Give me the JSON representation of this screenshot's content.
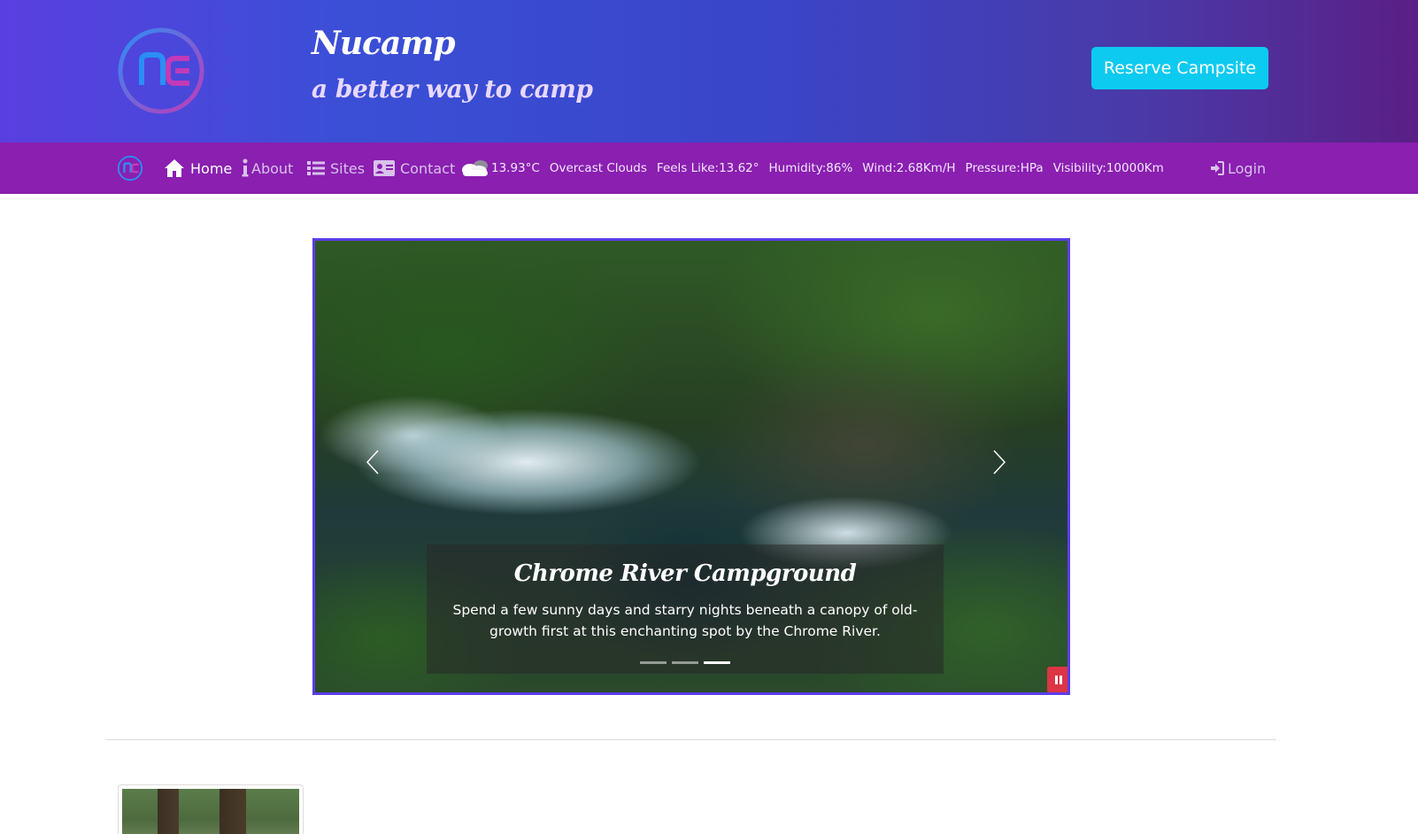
{
  "header": {
    "brand": "Nucamp",
    "tagline": "a better way to camp",
    "reserve_label": "Reserve Campsite"
  },
  "nav": {
    "items": [
      {
        "label": "Home",
        "icon": "home-icon",
        "active": true
      },
      {
        "label": "About",
        "icon": "info-icon",
        "active": false
      },
      {
        "label": "Sites",
        "icon": "list-icon",
        "active": false
      },
      {
        "label": "Contact",
        "icon": "address-card-icon",
        "active": false
      }
    ],
    "login_label": "Login"
  },
  "weather": {
    "icon": "cloud-icon",
    "temp": "13.93°C",
    "description": "Overcast Clouds",
    "feels_like": "Feels Like:13.62°",
    "humidity": "Humidity:86%",
    "wind": "Wind:2.68Km/H",
    "pressure": "Pressure:HPa",
    "visibility": "Visibility:10000Km"
  },
  "carousel": {
    "title": "Chrome River Campground",
    "text": "Spend a few sunny days and starry nights beneath a canopy of old-growth first at this enchanting spot by the Chrome River.",
    "slide_count": 3,
    "active_index": 2
  },
  "colors": {
    "header_start": "#5a3fe0",
    "header_end": "#5a1f86",
    "navbar": "#8a1fb0",
    "reserve_button": "#0dcaf0",
    "pause_button": "#dc3545",
    "carousel_border": "#5b3ee8"
  }
}
